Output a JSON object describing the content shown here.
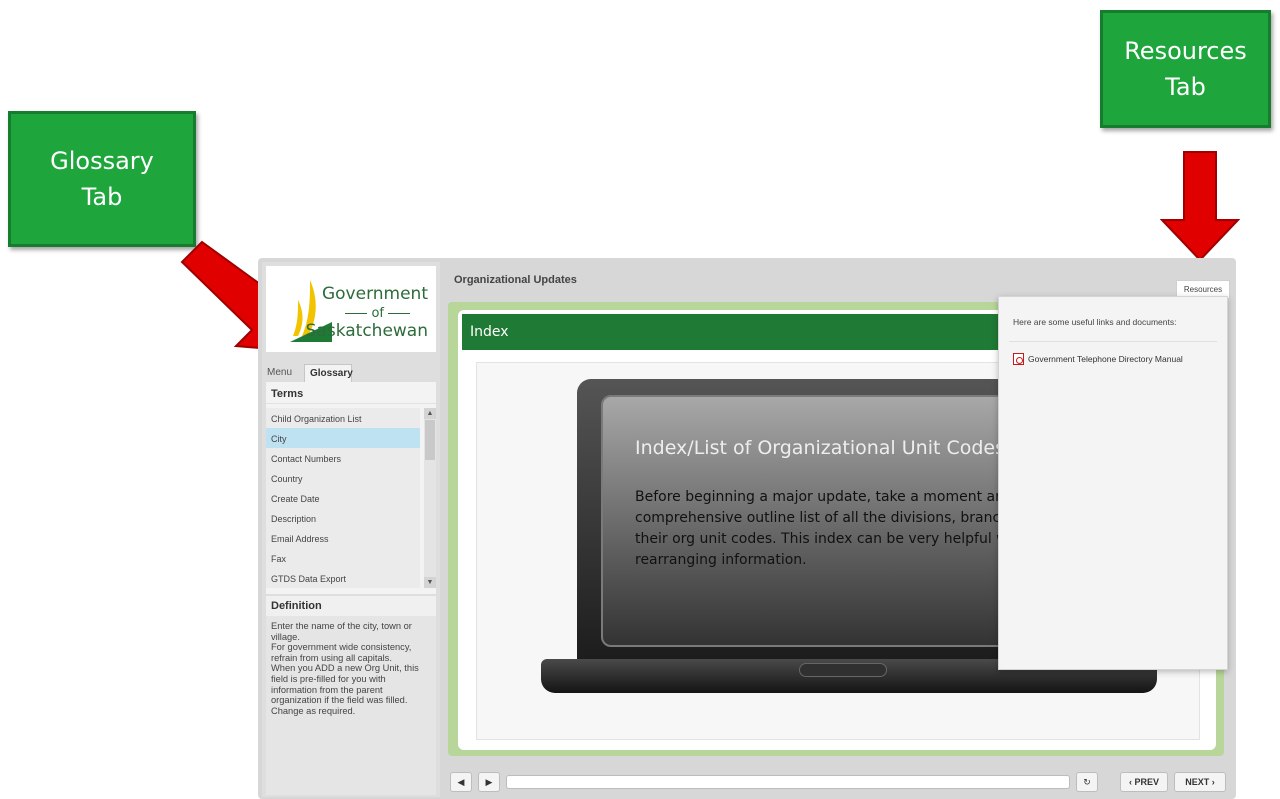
{
  "callouts": {
    "glossary": [
      "Glossary",
      "Tab"
    ],
    "resources": [
      "Resources",
      "Tab"
    ]
  },
  "logo": {
    "line1": "Government",
    "line2": "of",
    "line3": "Saskatchewan"
  },
  "tabs": {
    "menu": "Menu",
    "glossary": "Glossary"
  },
  "glossary": {
    "terms_header": "Terms",
    "terms": [
      "Child Organization List",
      "City",
      "Contact Numbers",
      "Country",
      "Create Date",
      "Description",
      "Email Address",
      "Fax",
      "GTDS Data Export"
    ],
    "selected_index": 1,
    "definition_header": "Definition",
    "definition_text": "Enter the name of the city, town or village.\nFor government wide consistency, refrain from using all capitals.\nWhen you ADD a new Org Unit, this field is pre-filled for you with information from the parent organization if the field was filled.\nChange as required."
  },
  "course_title": "Organizational Updates",
  "slide": {
    "section_title": "Index",
    "heading": "Index/List of Organizational Unit Codes",
    "body": "Before beginning a major update, take a moment and print this comprehensive outline list of all the divisions, branches, etc. and their org unit codes. This index can be very helpful when rearranging information."
  },
  "resources": {
    "tab_label": "Resources",
    "intro": "Here are some useful links and documents:",
    "links": [
      "Government Telephone Directory Manual"
    ]
  },
  "controls": {
    "mute_icon": "speaker-icon",
    "play_icon": "play-icon",
    "replay_icon": "replay-icon",
    "play_glyph": "▶",
    "mute_glyph": "◀",
    "replay_glyph": "↻",
    "prev_label": "‹ PREV",
    "next_label": "NEXT ›"
  },
  "colors": {
    "callout_green": "#1ea63d",
    "header_green": "#1f7a35",
    "stage_green": "#b8d69a",
    "arrow_red": "#e00000",
    "selected_term": "#bfe2f3"
  }
}
